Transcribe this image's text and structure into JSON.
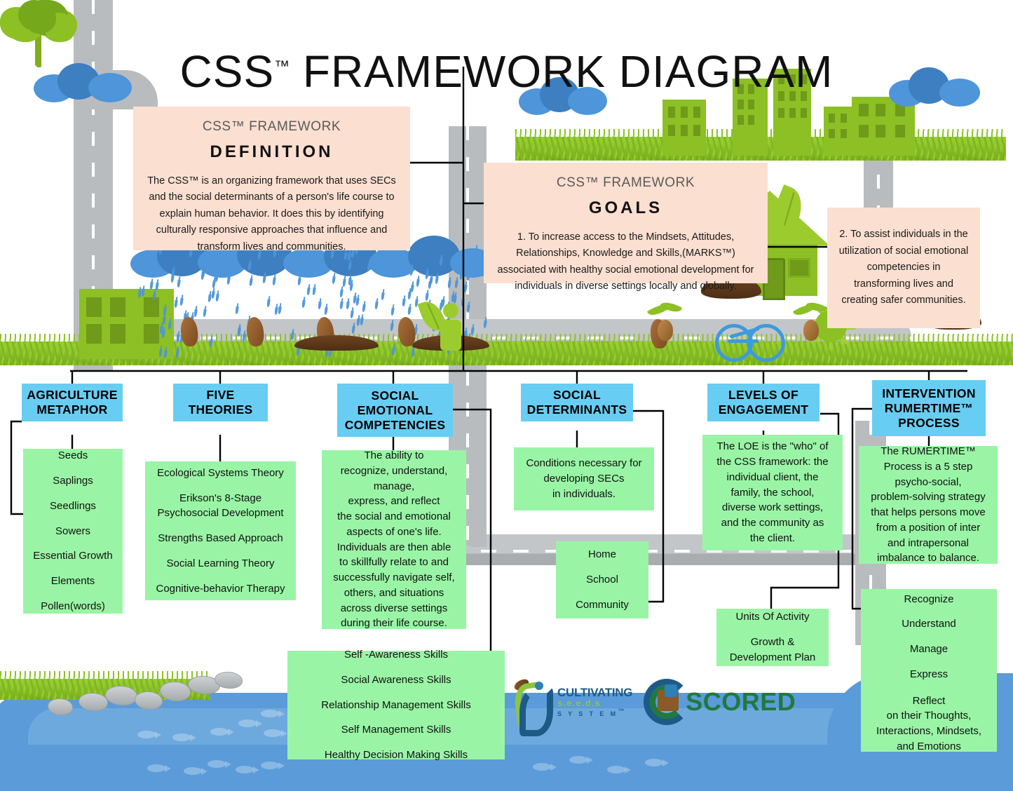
{
  "title": {
    "main": "CSS",
    "tm": "™",
    "rest": "FRAMEWORK DIAGRAM"
  },
  "definition_panel": {
    "name": "css-framework-definition",
    "title_line1": "CSS™ FRAMEWORK",
    "title_line2": "DEFINITION",
    "body": "The CSS™ is an organizing framework that uses SECs and the social determinants of a person's life course to explain human behavior. It does this by identifying culturally responsive approaches that influence and transform lives and communities."
  },
  "goals_panel": {
    "name": "css-framework-goals",
    "title_line1": "CSS™ FRAMEWORK",
    "title_line2": "GOALS",
    "goal1": "1. To increase access to the Mindsets, Attitudes, Relationships, Knowledge and Skills,(MARKS™) associated with healthy social emotional development for individuals in diverse settings locally and globally."
  },
  "goal2_panel": {
    "name": "css-framework-goal-2",
    "goal2": "2. To assist individuals in the utilization of social emotional competencies in transforming lives and creating safer communities."
  },
  "columns": [
    {
      "id": "agriculture-metaphor",
      "header": "AGRICULTURE METAPHOR",
      "boxes": [
        {
          "id": "agriculture-metaphor-terms",
          "lines": [
            "Seeds",
            "Saplings",
            "Seedlings",
            "Sowers",
            "Essential Growth",
            "Elements",
            "Pollen(words)"
          ],
          "spaced": true
        }
      ]
    },
    {
      "id": "five-theories",
      "header": "FIVE THEORIES",
      "boxes": [
        {
          "id": "five-theories-list",
          "lines": [
            "Ecological Systems Theory",
            "Erikson's 8-Stage",
            "Psychosocial Development",
            "Strengths Based Approach",
            "Social Learning Theory",
            "Cognitive-behavior Therapy"
          ],
          "spaced": true
        }
      ]
    },
    {
      "id": "social-emotional-competencies",
      "header": "SOCIAL EMOTIONAL COMPETENCIES",
      "boxes": [
        {
          "id": "sec-definition",
          "lines": [
            "The ability to",
            "recognize, understand,",
            "manage,",
            "express, and reflect",
            "the social and emotional",
            "aspects of one's life.",
            "Individuals are then able",
            "to skillfully relate to and",
            "successfully navigate self,",
            "others, and situations",
            "across diverse settings",
            "during their life course."
          ],
          "spaced": false
        },
        {
          "id": "sec-skills",
          "lines": [
            "Self -Awareness Skills",
            "Social Awareness Skills",
            "Relationship Management Skills",
            "Self Management Skills",
            "Healthy Decision Making Skills"
          ],
          "spaced": true
        }
      ]
    },
    {
      "id": "social-determinants",
      "header": "SOCIAL DETERMINANTS",
      "boxes": [
        {
          "id": "social-determinants-definition",
          "lines": [
            "Conditions necessary for",
            "developing  SECs",
            "in individuals."
          ],
          "spaced": false
        },
        {
          "id": "social-determinants-settings",
          "lines": [
            "Home",
            "School",
            "Community"
          ],
          "spaced": true
        }
      ]
    },
    {
      "id": "levels-of-engagement",
      "header": "LEVELS OF ENGAGEMENT",
      "boxes": [
        {
          "id": "loe-definition",
          "lines": [
            "The LOE is the \"who\" of",
            "the CSS framework: the",
            "individual client, the",
            "family, the school,",
            "diverse work settings,",
            "and the community as",
            "the client."
          ],
          "spaced": false
        },
        {
          "id": "loe-units",
          "lines": [
            "Units Of Activity",
            "Growth &",
            "Development Plan"
          ],
          "spaced": false
        }
      ]
    },
    {
      "id": "intervention-rumertime-process",
      "header": "INTERVENTION RUMERTIME™ PROCESS",
      "boxes": [
        {
          "id": "rumertime-definition",
          "lines": [
            "The RUMERTIME™",
            "Process is a 5 step",
            "psycho-social,",
            "problem-solving strategy",
            "that helps persons move",
            "from a position of inter",
            "and intrapersonal",
            "imbalance to balance."
          ],
          "spaced": false
        },
        {
          "id": "rumertime-steps",
          "lines": [
            "Recognize",
            "Understand",
            "Manage",
            "Express",
            "Reflect",
            "on their Thoughts,",
            "Interactions, Mindsets,",
            "and Emotions"
          ],
          "spaced": false
        }
      ]
    }
  ],
  "logos": {
    "cultivating": {
      "line1": "CULTIVATING",
      "line2": "s.e.e.d.s",
      "line3": "S Y S T E M",
      "tm": "™"
    },
    "gscored": {
      "text": "SCORED"
    }
  },
  "colors": {
    "panel_peach": "#fbdfd0",
    "header_blue": "#68cdf2",
    "box_green": "#99f5a5",
    "water_blue": "#5b9bd9",
    "foliage_green": "#8cc024",
    "road_gray": "#b9bcbe"
  }
}
